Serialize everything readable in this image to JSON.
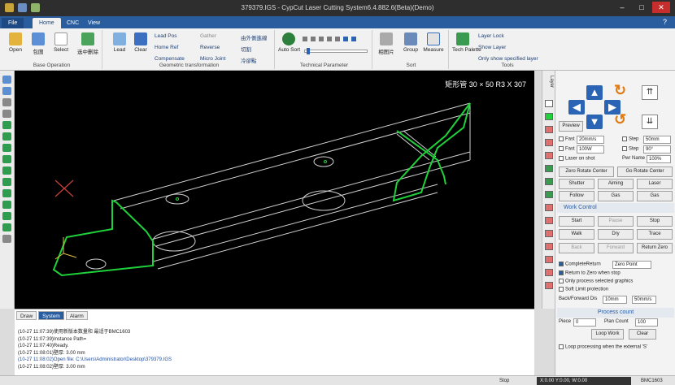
{
  "window": {
    "title": "379379.IGS - CypCut Laser Cutting System6.4.882.6(Beta)(Demo)"
  },
  "tabs": [
    {
      "label": "File"
    },
    {
      "label": "Home"
    },
    {
      "label": "CNC"
    },
    {
      "label": "View"
    }
  ],
  "ribbon": {
    "groups": [
      {
        "label": "Base Operation"
      },
      {
        "label": "Geometric transformation"
      },
      {
        "label": "Technical Parameter"
      },
      {
        "label": "Sort"
      },
      {
        "label": "Tools"
      }
    ],
    "buttons": {
      "open": "Open",
      "rotate_cn": "包圍",
      "select": "Select",
      "select_sub": "选中删除",
      "lead": "Lead",
      "clear": "Clear",
      "lead_pos": "Lead Pos",
      "home_ref": "Home Ref",
      "compensate": "Compensate",
      "gather": "Gather",
      "reverse": "Reverse",
      "micro_joint": "Micro Joint",
      "cn1": "由外側進線",
      "cn2": "切割",
      "cn3": "冷卻點",
      "auto_sort": "Auto Sort",
      "cn_sort": "相图片",
      "group": "Group",
      "measure": "Measure",
      "tech_palette": "Tech Palette",
      "layer_lock": "Layer Lock",
      "show_layer": "Show Layer",
      "only_show": "Only show specified layer"
    }
  },
  "canvas": {
    "caption": "矩形管 30 × 50 R3 X 307"
  },
  "console": {
    "tabs": [
      {
        "label": "Draw"
      },
      {
        "label": "System"
      },
      {
        "label": "Alarm"
      }
    ],
    "lines": [
      {
        "text": "(10-27 11:07:39)使用新版本数量和 最适于BMC1603"
      },
      {
        "text": "(10-27 11:07:39)Instance Path="
      },
      {
        "text": "(10-27 11:07:40)Ready."
      },
      {
        "text": "(10-27 11:08:01)壁厚: 3.00 mm"
      },
      {
        "text": "(10-27 11:08:02)Open file: C:\\Users\\Administrator\\Desktop\\379379.IGS"
      },
      {
        "text": "(10-27 11:08:02)壁厚: 3.00 mm"
      }
    ]
  },
  "layer_panel": {
    "label": "Layer"
  },
  "panel": {
    "preview": "Preview",
    "fast": {
      "label": "Fast",
      "value": "20mm/s"
    },
    "step": {
      "label": "Step",
      "value": "50mm"
    },
    "fast2": {
      "label": "Fast",
      "value": "100W"
    },
    "step2": {
      "label": "Step",
      "value": "90°"
    },
    "laser_on_shot": "Laser on shot",
    "pwr_name": "Pwr Name",
    "pwr_value": "100%",
    "zero_rotate": "Zero Rotate Center",
    "go_rotate": "Go Rotate Center",
    "shutter": "Shutter",
    "aiming": "Aiming",
    "laser": "Laser",
    "follow": "Follow",
    "gas1": "Gas",
    "gas2": "Gas",
    "work_control": "Work Control",
    "start": "Start",
    "pause": "Pause",
    "stop": "Stop",
    "walk": "Walk",
    "dry": "Dry",
    "trace": "Trace",
    "back": "Back",
    "forward": "Forward",
    "return_zero": "Return Zero",
    "complete_return": "CompleteReturn",
    "complete_return_value": "Zero Point",
    "return_to_zero": "Return to Zero when stop",
    "only_process": "Only process selected graphics",
    "soft_limit": "Soft Limit protection",
    "back_forward_dis": "Back/Forward Dis",
    "bf_value": "10mm",
    "bf_speed": "50mm/s",
    "process_count": "Process count",
    "piece_label": "Piece",
    "piece_value": "0",
    "plan_count_label": "Plan Count",
    "plan_count_value": "100",
    "loop_work": "Loop Work",
    "clear": "Clear",
    "loop_processing": "Loop processing when the external 'S'"
  },
  "statusbar": {
    "stop": "Stop",
    "coords": "X:0.00 Y:0.00, W:0.00",
    "card": "BMC1603"
  },
  "colors": {
    "accent": "#2a5d9e",
    "path": "#1fd13a",
    "canvas": "#000000"
  }
}
